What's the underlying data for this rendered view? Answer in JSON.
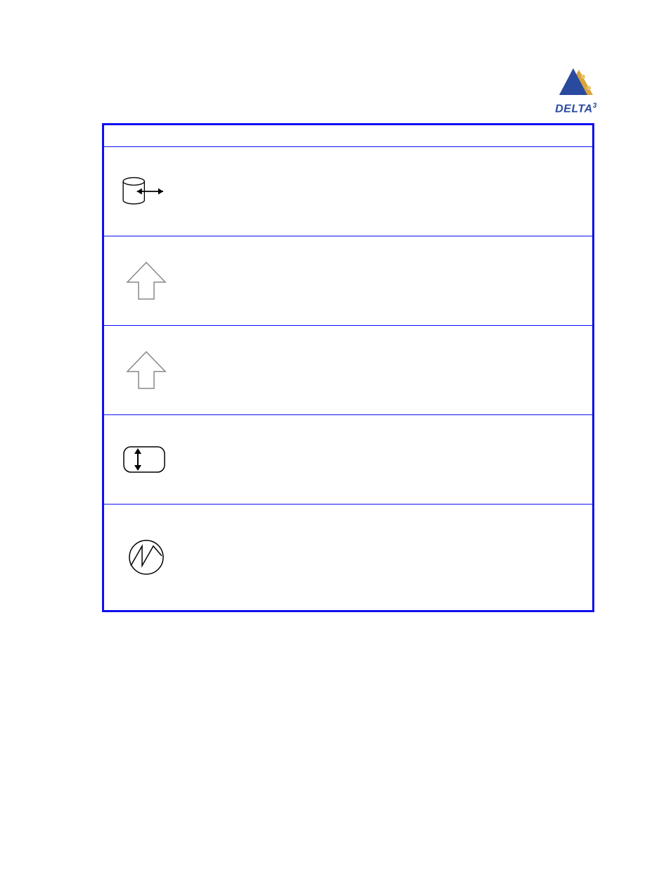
{
  "logo": {
    "brand": "DELTA",
    "superscript": "3"
  },
  "table": {
    "rows": [
      {
        "icon": "cylinder-output-icon"
      },
      {
        "icon": "arrow-up-outline-icon"
      },
      {
        "icon": "arrow-up-outline-icon"
      },
      {
        "icon": "rounded-rect-updown-icon"
      },
      {
        "icon": "circle-sawtooth-icon"
      }
    ]
  }
}
